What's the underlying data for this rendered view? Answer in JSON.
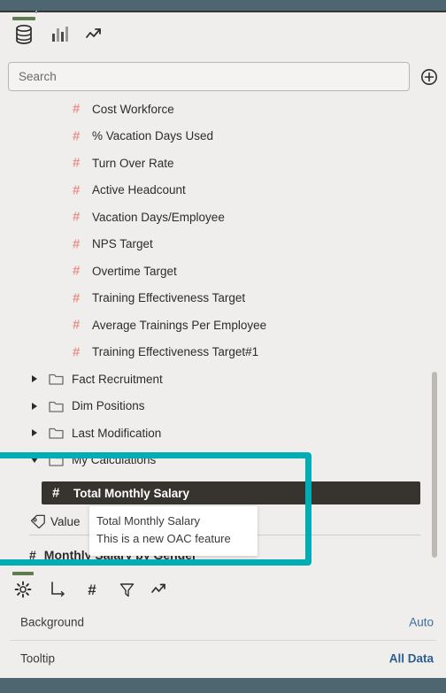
{
  "colors": {
    "chrome": "#4d6670",
    "accent_green": "#5d7c4f",
    "callout_teal": "#00adb5",
    "measure_hash": "#e8938a",
    "selected_row_bg": "#37332e",
    "link_blue": "#3b6e9b"
  },
  "tabs": [
    {
      "id": "data",
      "icon": "database-icon",
      "active": true
    },
    {
      "id": "visualize",
      "icon": "bar-chart-icon",
      "active": false
    },
    {
      "id": "analytics",
      "icon": "trend-line-icon",
      "active": false
    }
  ],
  "search": {
    "placeholder": "Search",
    "value": "",
    "add_icon": "plus-circle-icon"
  },
  "tree": {
    "measures": [
      "Cost Workforce",
      "% Vacation Days Used",
      "Turn Over Rate",
      "Active Headcount",
      "Vacation Days/Employee",
      "NPS Target",
      "Overtime Target",
      "Training Effectiveness Target",
      "Average Trainings Per Employee",
      "Training Effectiveness Target#1"
    ],
    "folders": [
      {
        "label": "Fact Recruitment",
        "expanded": false
      },
      {
        "label": "Dim Positions",
        "expanded": false
      },
      {
        "label": "Last Modification",
        "expanded": false
      },
      {
        "label": "My Calculations",
        "expanded": true
      }
    ],
    "selected_measure": "Total Monthly Salary",
    "value_row": "Value",
    "clipped_row": "Monthly Salary by Gender"
  },
  "tooltip": {
    "title": "Total Monthly Salary",
    "description": "This is a new OAC feature"
  },
  "properties": {
    "tabs": [
      {
        "id": "general",
        "icon": "gear-icon",
        "active": true
      },
      {
        "id": "axis",
        "icon": "axis-icon",
        "active": false
      },
      {
        "id": "values",
        "icon": "hash-icon",
        "active": false
      },
      {
        "id": "filters",
        "icon": "filter-icon",
        "active": false
      },
      {
        "id": "analytics",
        "icon": "trend-line-icon",
        "active": false
      }
    ],
    "rows": [
      {
        "name": "Background",
        "value": "Auto",
        "strong": false
      },
      {
        "name": "Tooltip",
        "value": "All Data",
        "strong": true
      }
    ]
  }
}
